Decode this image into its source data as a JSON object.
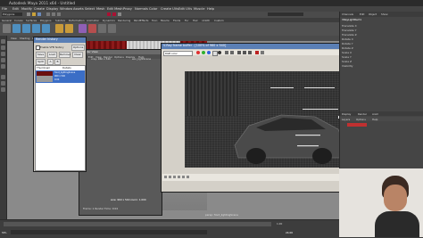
{
  "app": {
    "title": "Autodesk Maya 2011 x64 - Untitled",
    "menus": [
      "File",
      "Edit",
      "Modify",
      "Create",
      "Display",
      "Window",
      "Assets",
      "Select",
      "Mesh",
      "Edit Mesh",
      "Proxy",
      "Normals",
      "Color",
      "Create UVs",
      "Edit UVs",
      "Muscle",
      "Help"
    ],
    "mode": "Polygons"
  },
  "shelf": {
    "tabs": [
      "General",
      "Curves",
      "Surfaces",
      "Polygons",
      "Subdivs",
      "Deformation",
      "Animation",
      "Dynamics",
      "Rendering",
      "PaintEffects",
      "Toon",
      "Muscle",
      "Fluids",
      "Fur",
      "Hair",
      "nCloth",
      "Custom"
    ]
  },
  "viewport": {
    "menus": [
      "View",
      "Shading",
      "Lighting",
      "Show",
      "Renderer",
      "Panels"
    ],
    "resolution_label": "vray: 960 x 540",
    "camera_label": "persp: front_lightingScene"
  },
  "render_view": {
    "title": "Render View",
    "menus": [
      "File",
      "Edit",
      "View",
      "Render",
      "Options",
      "Display",
      "Help"
    ],
    "size_label": "size: 960 x 540  zoom: 1.000",
    "status": "Frame: 1  Render Time: 0:04"
  },
  "render_history": {
    "title": "Render history",
    "checkbox_label": "Enable VFB history",
    "options_label": "Options",
    "buttons": [
      "Save",
      "Load",
      "Remove",
      "Clear",
      "Split",
      "A",
      "B"
    ],
    "columns": [
      "Thumbnail",
      "Details"
    ],
    "entry_details": [
      "front_lightingScene",
      "960 x 540",
      "0:04"
    ]
  },
  "vfb": {
    "title": "V-Ray frame buffer - [100% of 960 x 540]",
    "channel": "RGB color",
    "menus": [
      "File",
      "Render"
    ]
  },
  "right_panel": {
    "tabs": [
      "Channels",
      "Edit",
      "Object",
      "Show"
    ],
    "object": "VRayLightRect1",
    "fields": [
      "Translate X",
      "Translate Y",
      "Translate Z",
      "Rotate X",
      "Rotate Y",
      "Rotate Z",
      "Scale X",
      "Scale Y",
      "Scale Z",
      "Visibility"
    ],
    "layers_tabs": [
      "Display",
      "Render",
      "Anim"
    ],
    "layer_labels": [
      "Layers",
      "Options",
      "Help"
    ]
  },
  "bottom": {
    "frame_value": "1.00",
    "mel_label": "MEL",
    "time_value": "24.00"
  },
  "colors": {
    "accent_title": "#5a7fb5",
    "curtain_red": "#7a1010",
    "selected_blue": "#3b6ec6"
  }
}
